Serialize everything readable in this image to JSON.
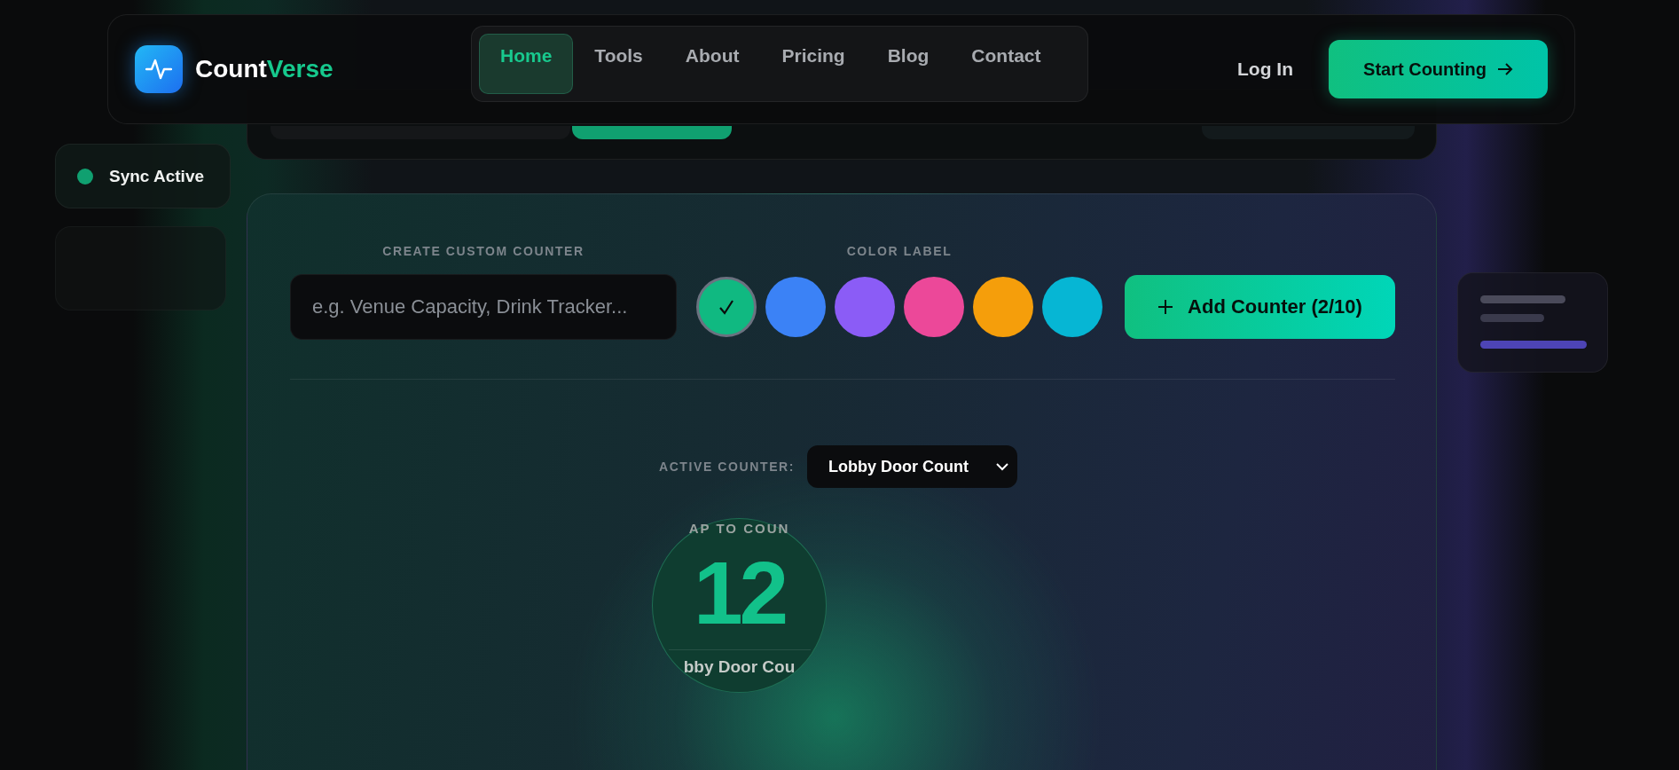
{
  "brand": {
    "name": "Count",
    "accent": "Verse"
  },
  "nav": {
    "items": [
      {
        "label": "Home",
        "selected": true
      },
      {
        "label": "Tools",
        "selected": false
      },
      {
        "label": "About",
        "selected": false
      },
      {
        "label": "Pricing",
        "selected": false
      },
      {
        "label": "Blog",
        "selected": false
      },
      {
        "label": "Contact",
        "selected": false
      }
    ]
  },
  "header_actions": {
    "login": "Log In",
    "cta": "Start Counting"
  },
  "sync_status": {
    "label": "Sync Active"
  },
  "create_counter": {
    "label": "CREATE CUSTOM COUNTER",
    "input": {
      "placeholder": "e.g. Venue Capacity, Drink Tracker..."
    }
  },
  "color_picker": {
    "label": "COLOR LABEL",
    "swatches": [
      {
        "color": "#10b981",
        "selected": true
      },
      {
        "color": "#3b82f6",
        "selected": false
      },
      {
        "color": "#8b5cf6",
        "selected": false
      },
      {
        "color": "#ec4899",
        "selected": false
      },
      {
        "color": "#f59e0b",
        "selected": false
      },
      {
        "color": "#06b6d4",
        "selected": false
      }
    ]
  },
  "add_button": {
    "label": "Add Counter (2/10)"
  },
  "active_counter": {
    "label": "ACTIVE COUNTER:",
    "value": "Lobby Door Count"
  },
  "counter_display": {
    "hint": "AP TO COUN",
    "count": "12",
    "name": "bby Door Cou"
  }
}
